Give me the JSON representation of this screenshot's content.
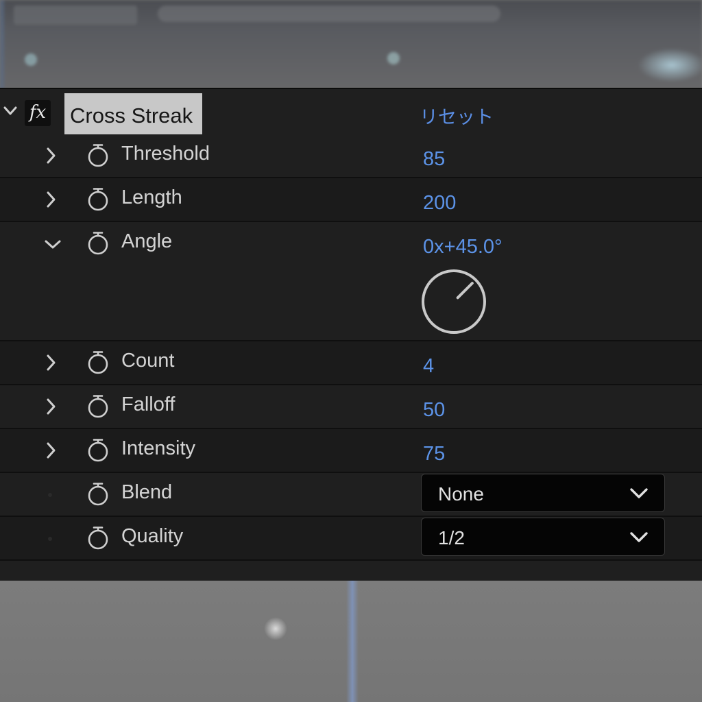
{
  "effect": {
    "name": "Cross Streak",
    "fx_label": "fx",
    "reset_label": "リセット"
  },
  "properties": [
    {
      "label": "Threshold",
      "value": "85",
      "expanded": false
    },
    {
      "label": "Length",
      "value": "200",
      "expanded": false
    },
    {
      "label": "Angle",
      "value": "0x+45.0°",
      "expanded": true
    },
    {
      "label": "Count",
      "value": "4",
      "expanded": false
    },
    {
      "label": "Falloff",
      "value": "50",
      "expanded": false
    },
    {
      "label": "Intensity",
      "value": "75",
      "expanded": false
    },
    {
      "label": "Blend",
      "value": "None",
      "type": "dropdown"
    },
    {
      "label": "Quality",
      "value": "1/2",
      "type": "dropdown"
    }
  ],
  "angle_dial": {
    "degrees": 45
  },
  "colors": {
    "value_blue": "#5c93e8",
    "panel_bg": "#1f1f1f",
    "highlight": "#c8c8c8"
  }
}
